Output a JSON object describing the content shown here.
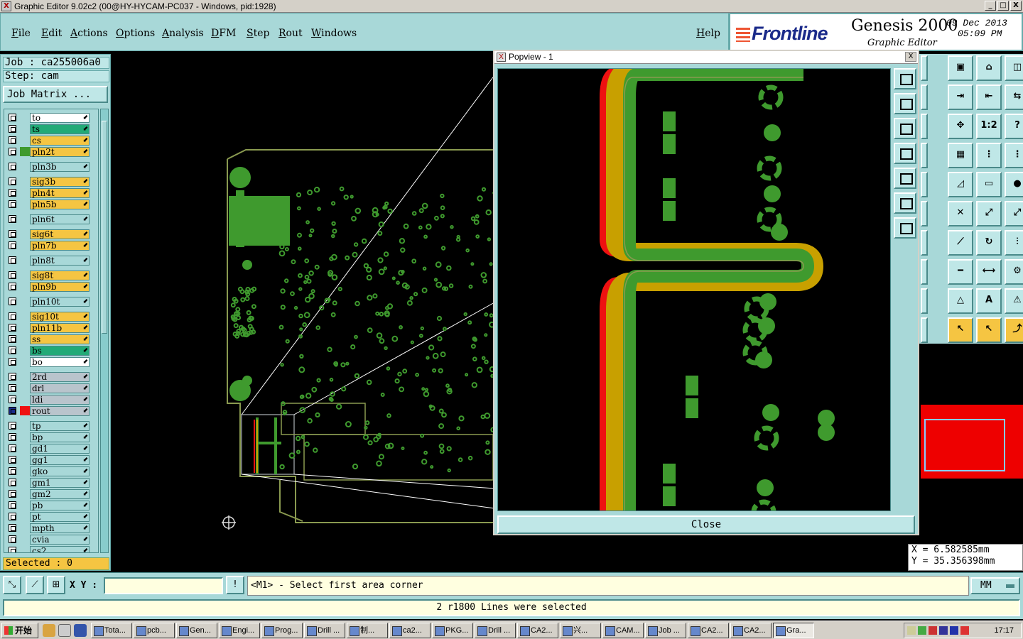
{
  "window": {
    "title": "Graphic Editor 9.02c2 (00@HY-HYCAM-PC037 - Windows, pid:1928)",
    "btn_min": "_",
    "btn_max": "□",
    "btn_close": "X"
  },
  "menu": {
    "items": [
      "File",
      "Edit",
      "Actions",
      "Options",
      "Analysis",
      "DFM",
      "Step",
      "Rout",
      "Windows"
    ],
    "help": "Help"
  },
  "brand": {
    "logo": "Frontline",
    "product": "Genesis 2000",
    "subtitle": "Graphic Editor",
    "date": "09 Dec 2013",
    "time": "05:09 PM"
  },
  "job": {
    "job_line": "Job : ca255006a0",
    "step_line": "Step: cam",
    "matrix_button": "Job Matrix ..."
  },
  "layers": [
    {
      "name": "to",
      "color": "#ffffff"
    },
    {
      "name": "ts",
      "color": "#22aa77"
    },
    {
      "name": "cs",
      "color": "#f5c542"
    },
    {
      "name": "pln2t",
      "color": "#f5c542",
      "swatch": "#3f9a2e"
    },
    {
      "name": "pln3b",
      "color": "#a8d8d8"
    },
    {
      "name": "sig3b",
      "color": "#f5c542"
    },
    {
      "name": "pln4t",
      "color": "#f5c542"
    },
    {
      "name": "pln5b",
      "color": "#f5c542"
    },
    {
      "name": "pln6t",
      "color": "#a8d8d8"
    },
    {
      "name": "sig6t",
      "color": "#f5c542"
    },
    {
      "name": "pln7b",
      "color": "#f5c542"
    },
    {
      "name": "pln8t",
      "color": "#a8d8d8"
    },
    {
      "name": "sig8t",
      "color": "#f5c542"
    },
    {
      "name": "pln9b",
      "color": "#f5c542"
    },
    {
      "name": "pln10t",
      "color": "#a8d8d8"
    },
    {
      "name": "sig10t",
      "color": "#f5c542"
    },
    {
      "name": "pln11b",
      "color": "#f5c542"
    },
    {
      "name": "ss",
      "color": "#f5c542"
    },
    {
      "name": "bs",
      "color": "#22aa77"
    },
    {
      "name": "bo",
      "color": "#ffffff"
    },
    {
      "name": "2rd",
      "color": "#b9c4cc"
    },
    {
      "name": "drl",
      "color": "#b9c4cc"
    },
    {
      "name": "ldi",
      "color": "#b9c4cc"
    },
    {
      "name": "rout",
      "color": "#b9c4cc",
      "swatch": "#ee1111",
      "active": true
    },
    {
      "name": "tp",
      "color": "#a8d8d8"
    },
    {
      "name": "bp",
      "color": "#a8d8d8"
    },
    {
      "name": "gd1",
      "color": "#a8d8d8"
    },
    {
      "name": "gg1",
      "color": "#a8d8d8"
    },
    {
      "name": "gko",
      "color": "#a8d8d8"
    },
    {
      "name": "gm1",
      "color": "#a8d8d8"
    },
    {
      "name": "gm2",
      "color": "#a8d8d8"
    },
    {
      "name": "pb",
      "color": "#a8d8d8"
    },
    {
      "name": "pt",
      "color": "#a8d8d8"
    },
    {
      "name": "mpth",
      "color": "#a8d8d8"
    },
    {
      "name": "cvia",
      "color": "#a8d8d8"
    },
    {
      "name": "cs2",
      "color": "#a8d8d8"
    }
  ],
  "selected_text": "Selected : 0",
  "popview": {
    "title": "Popview - 1",
    "close_x": "X",
    "close_button": "Close"
  },
  "coords": {
    "x": "X = 6.582585mm",
    "y": "Y = 35.356398mm"
  },
  "command": {
    "xy_label": "X Y :",
    "xy_value": "",
    "info_btn": "!",
    "prompt": "<M1> - Select first area corner",
    "units": "MM"
  },
  "status_message": "2 r1800 Lines were selected",
  "taskbar": {
    "start": "开始",
    "tasks": [
      "Tota...",
      "pcb...",
      "Gen...",
      "Engi...",
      "Prog...",
      "Drill ...",
      "制...",
      "ca2...",
      "PKG...",
      "Drill ...",
      "CA2...",
      "兴...",
      "CAM...",
      "Job ...",
      "CA2...",
      "CA2...",
      "Gra..."
    ],
    "clock": "17:17"
  },
  "colors": {
    "panel": "#a8d8d8",
    "trace_green": "#3f9a2e",
    "trace_gold": "#c8a000",
    "rout_red": "#ee1111",
    "outline": "#8a9a50"
  }
}
